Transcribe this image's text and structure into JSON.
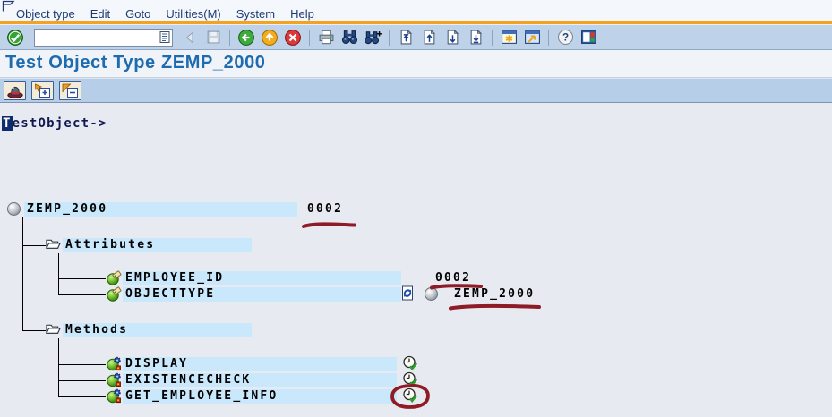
{
  "menu_bar": {
    "items": [
      "Object type",
      "Edit",
      "Goto",
      "Utilities(M)",
      "System",
      "Help"
    ]
  },
  "toolbar": {
    "command_field": {
      "value": ""
    },
    "icons": [
      "enter-check",
      "command-field",
      "back-step",
      "save",
      "back-nav",
      "exit",
      "cancel",
      "print",
      "find",
      "find-next",
      "first-page",
      "previous-page",
      "next-page",
      "last-page",
      "new-session",
      "create-shortcut",
      "help",
      "customize-layout"
    ]
  },
  "header": {
    "title": "Test Object Type ZEMP_2000"
  },
  "app_toolbar": {
    "buttons": [
      {
        "name": "create-instance-hat"
      },
      {
        "name": "expand-node"
      },
      {
        "name": "collapse-node"
      }
    ]
  },
  "content": {
    "interface_label": {
      "first_char": "T",
      "rest": "estObject->"
    },
    "tree": {
      "root": {
        "label": "ZEMP_2000",
        "value": "0002"
      },
      "attributes": {
        "label": "Attributes",
        "items": [
          {
            "label": "EMPLOYEE_ID",
            "value": "0002"
          },
          {
            "label": "OBJECTTYPE",
            "value": "ZEMP_2000"
          }
        ]
      },
      "methods": {
        "label": "Methods",
        "items": [
          {
            "label": "DISPLAY"
          },
          {
            "label": "EXISTENCECHECK"
          },
          {
            "label": "GET_EMPLOYEE_INFO"
          }
        ]
      }
    }
  },
  "annotations": {
    "color": "#8E1B26",
    "underlined_values": [
      "0002",
      "0002",
      "ZEMP_2000"
    ],
    "circled": "execute-icon-of-GET_EMPLOYEE_INFO"
  },
  "colors": {
    "menu_accent_orange": "#F5A21F",
    "toolbar_bg": "#BED3EA",
    "row_highlight": "#C9E8FC",
    "title_blue": "#1E6CB0",
    "content_bg": "#E7EAF1"
  }
}
